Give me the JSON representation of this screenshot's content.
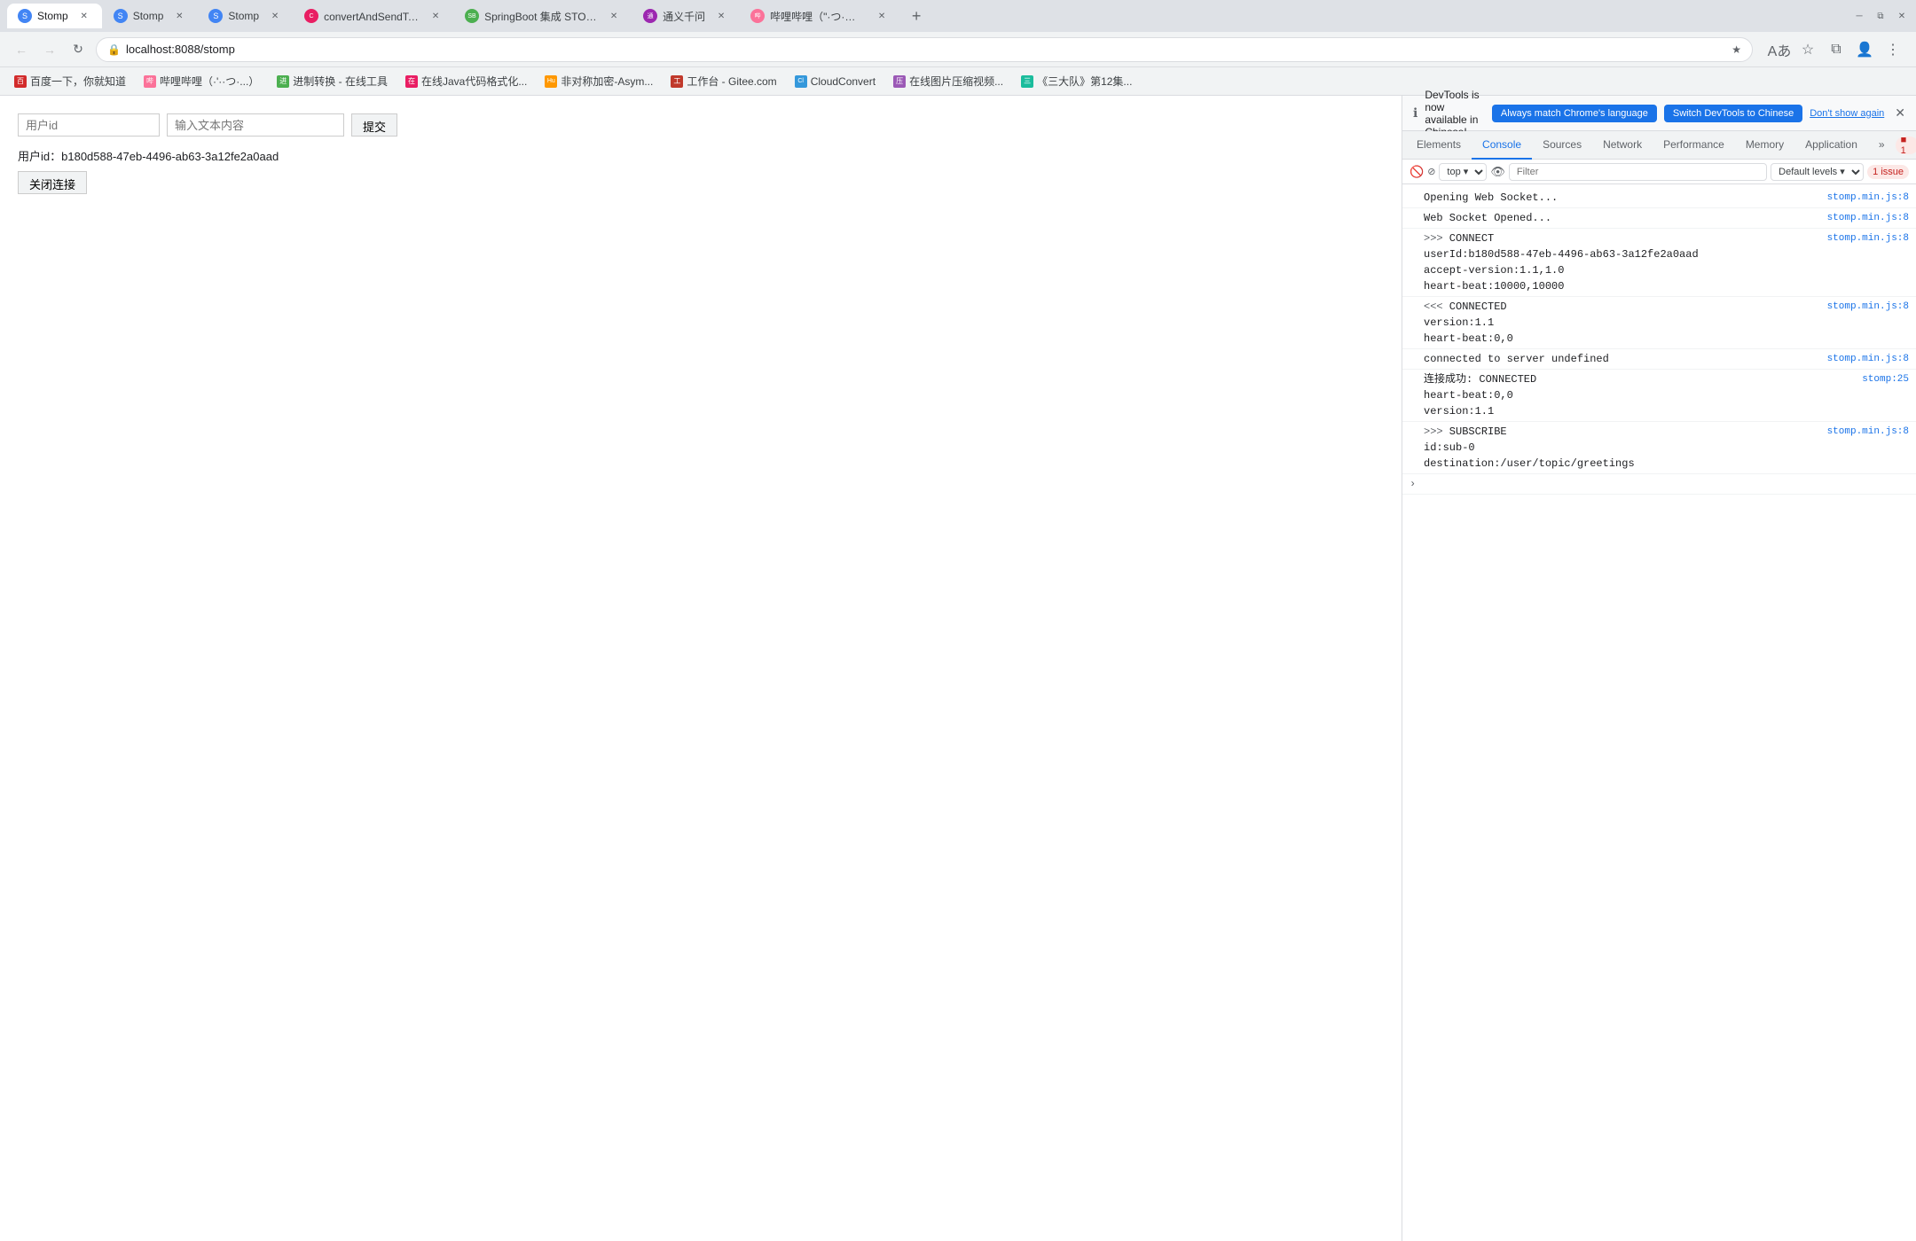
{
  "browser": {
    "tabs": [
      {
        "id": "tab-stomp-1",
        "favicon": "S",
        "title": "Stomp",
        "active": true,
        "url": "localhost:8088/stomp"
      },
      {
        "id": "tab-stomp-2",
        "favicon": "S",
        "title": "Stomp",
        "active": false,
        "url": ""
      },
      {
        "id": "tab-stomp-3",
        "favicon": "S",
        "title": "Stomp",
        "active": false,
        "url": ""
      },
      {
        "id": "tab-convert",
        "favicon": "C",
        "title": "convertAndSendToUser示例",
        "active": false,
        "url": ""
      },
      {
        "id": "tab-springboot",
        "favicon": "SB",
        "title": "SpringBoot 集成 STOMP 实习",
        "active": false,
        "url": ""
      },
      {
        "id": "tab-tongyi",
        "favicon": "T",
        "title": "通义千问",
        "active": false,
        "url": ""
      },
      {
        "id": "tab-popo",
        "favicon": "P",
        "title": "哔哩哔哩（\"·つ·ロ 千杯...b",
        "active": false,
        "url": ""
      }
    ],
    "address": "localhost:8088/stomp",
    "bookmarks": [
      {
        "id": "bm-baidu",
        "favicon": "百",
        "label": "百度一下，你就知道"
      },
      {
        "id": "bm-popo",
        "favicon": "哔",
        "label": "哔哩哔哩（·'··つ·...）"
      },
      {
        "id": "bm-convert",
        "favicon": "进",
        "label": "进制转换 - 在线工具"
      },
      {
        "id": "bm-java",
        "favicon": "在",
        "label": "在线Java代码格式化..."
      },
      {
        "id": "bm-humor",
        "favicon": "Hu",
        "label": "非对称加密-Asym..."
      },
      {
        "id": "bm-gitee",
        "favicon": "工",
        "label": "工作台 - Gitee.com"
      },
      {
        "id": "bm-cloudconvert",
        "favicon": "Cl",
        "label": "CloudConvert"
      },
      {
        "id": "bm-compress",
        "favicon": "压",
        "label": "在线图片压缩视频..."
      },
      {
        "id": "bm-sandalian",
        "favicon": "三",
        "label": "《三大队》第12集..."
      }
    ]
  },
  "webpage": {
    "user_id_placeholder": "用户id",
    "message_placeholder": "输入文本内容",
    "submit_label": "提交",
    "user_id_label": "用户id：",
    "user_id_value": "b180d588-47eb-4496-ab63-3a12fe2a0aad",
    "close_conn_label": "关闭连接"
  },
  "devtools": {
    "notification": {
      "text": "DevTools is now available in Chinese!",
      "btn_match": "Always match Chrome's language",
      "btn_switch": "Switch DevTools to Chinese",
      "btn_dismiss": "Don't show again"
    },
    "tabs": [
      "Elements",
      "Console",
      "Sources",
      "Network",
      "Performance",
      "Memory",
      "Application",
      "More"
    ],
    "active_tab": "Console",
    "subtoolbar": {
      "level_label": "top",
      "filter_placeholder": "Filter",
      "default_levels": "Default levels",
      "issue_count": "1 issue",
      "issue_badge": "1"
    },
    "console_lines": [
      {
        "id": "line-1",
        "type": "info",
        "text": "Opening Web Socket...",
        "source": "stomp.min.js:8",
        "expand": false
      },
      {
        "id": "line-2",
        "type": "info",
        "text": "Web Socket Opened...",
        "source": "stomp.min.js:8",
        "expand": false
      },
      {
        "id": "line-3",
        "type": "send",
        "text": ">>> CONNECT\nuserId:b180d588-47eb-4496-ab63-3a12fe2a0aad\naccept-version:1.1,1.0\nheart-beat:10000,10000",
        "source": "stomp.min.js:8",
        "expand": false
      },
      {
        "id": "line-4",
        "type": "receive",
        "text": "<<< CONNECTED\nversion:1.1\nheart-beat:0,0",
        "source": "stomp.min.js:8",
        "expand": false
      },
      {
        "id": "line-5",
        "type": "info",
        "text": "connected to server undefined",
        "source": "stomp.min.js:8",
        "expand": false
      },
      {
        "id": "line-6",
        "type": "info",
        "text": "连接成功: CONNECTED\nheart-beat:0,0\nversion:1.1",
        "source": "stomp:25",
        "expand": false
      },
      {
        "id": "line-7",
        "type": "send",
        "text": ">>> SUBSCRIBE\nid:sub-0\ndestination:/user/topic/greetings",
        "source": "stomp.min.js:8",
        "expand": false
      }
    ],
    "expand_icon": "›",
    "icons": {
      "inspect": "⬡",
      "console_panel": "☰",
      "sources_panel": "◎",
      "close": "✕",
      "settings": "⚙",
      "more": "⋮",
      "dock": "⊡",
      "search": "🔍",
      "eye": "👁",
      "block": "🚫",
      "clear": "🚫",
      "errors_badge": "1"
    }
  }
}
